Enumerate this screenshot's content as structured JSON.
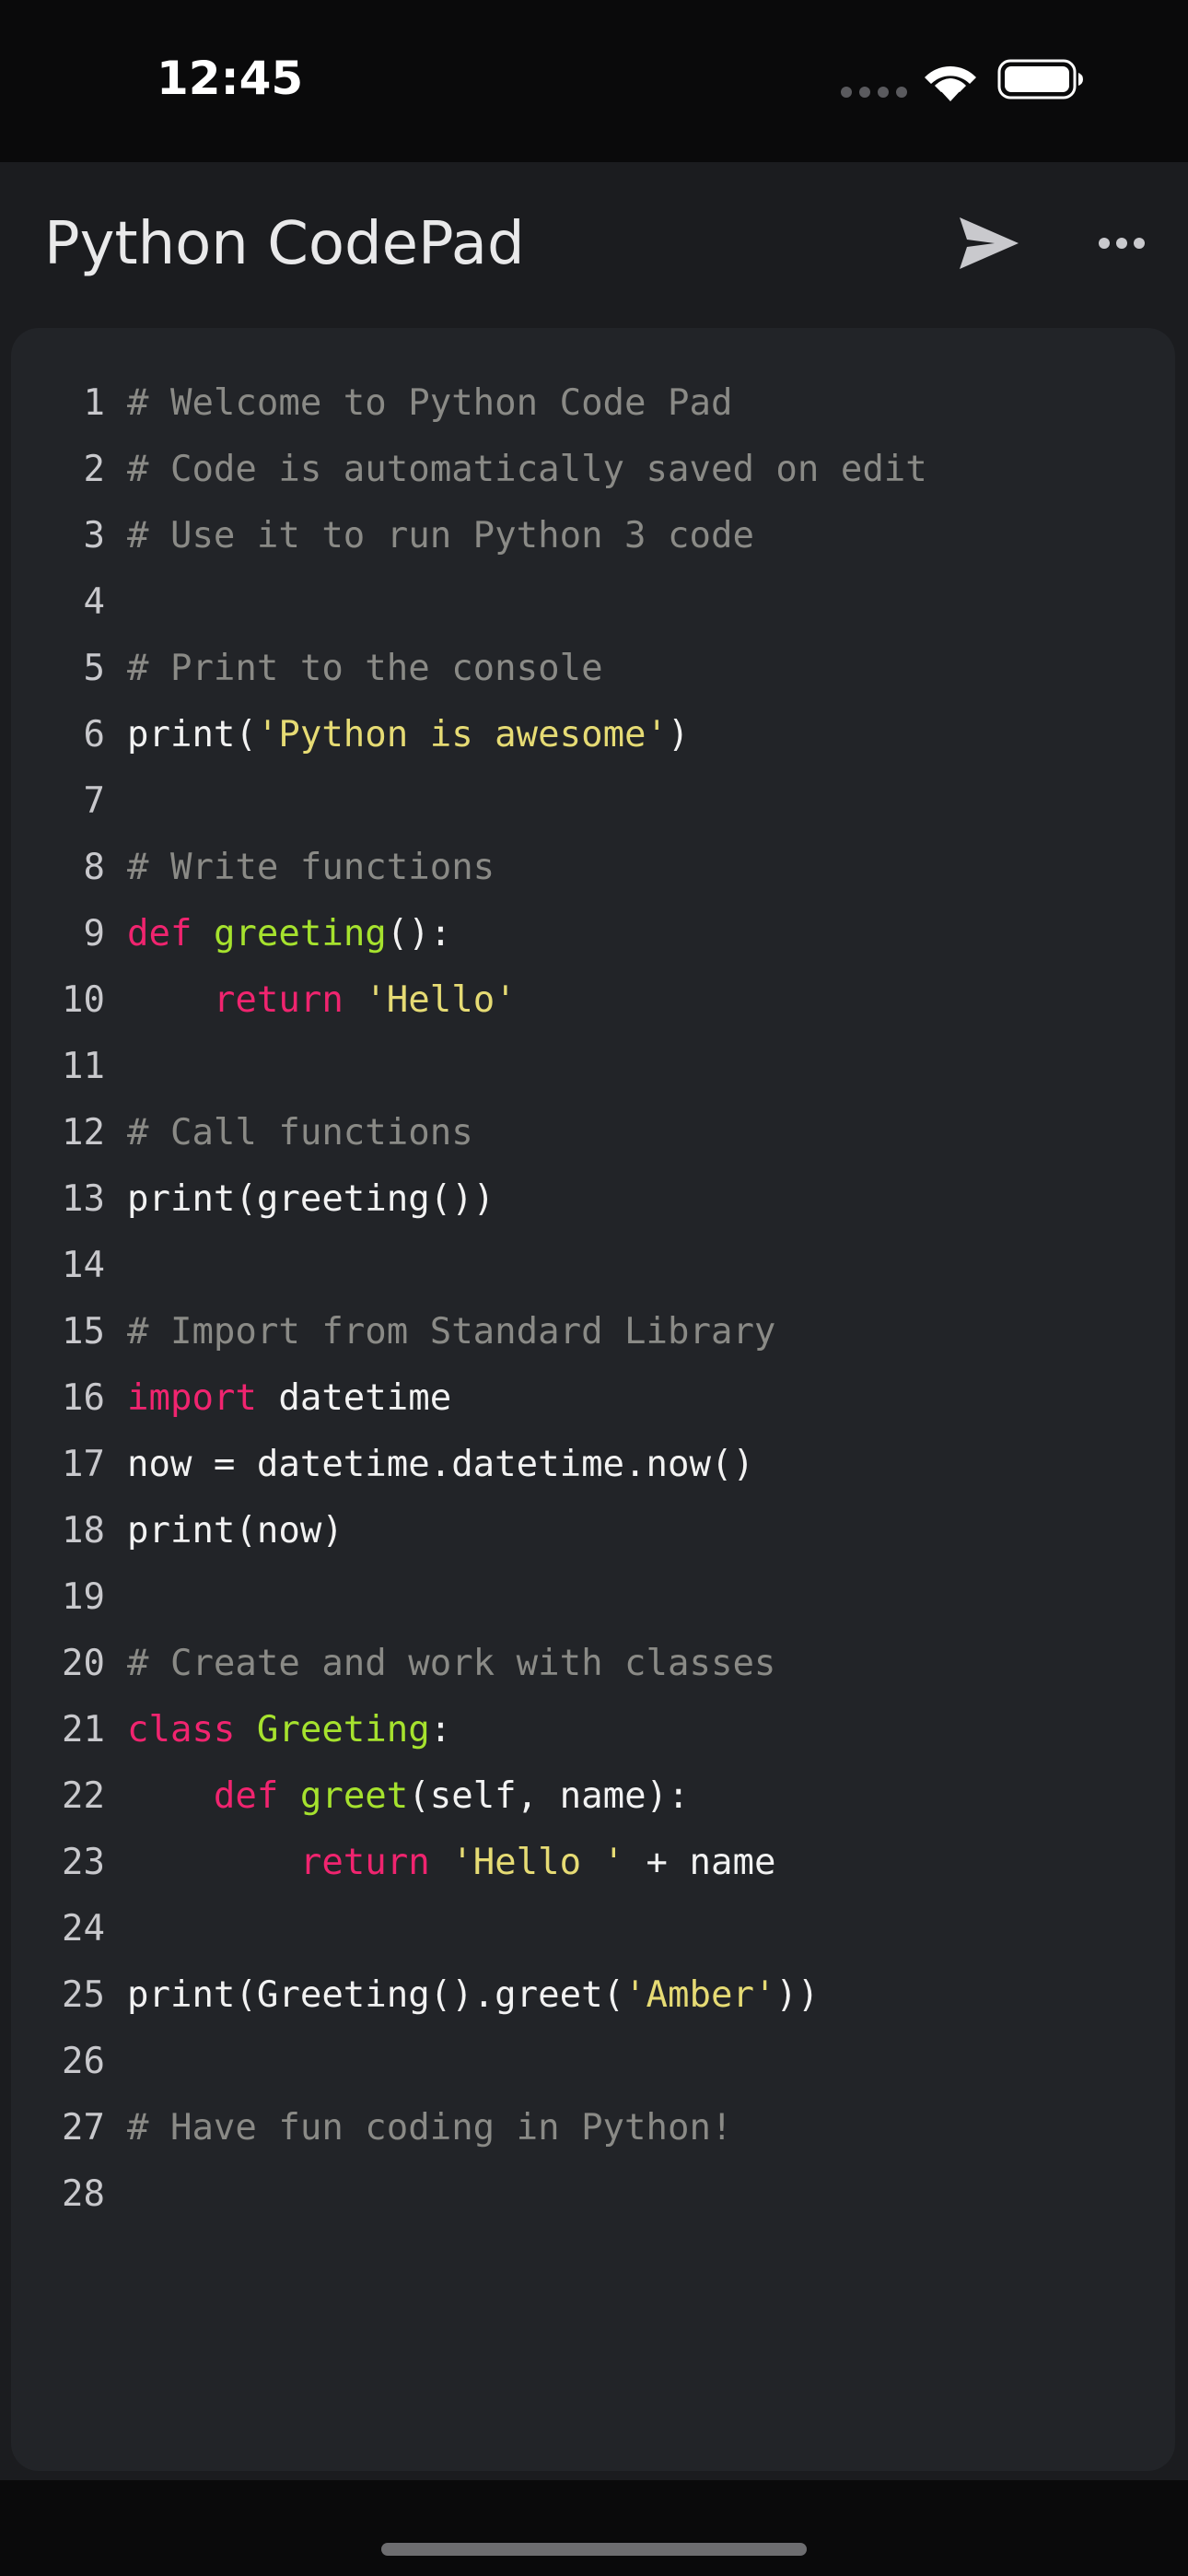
{
  "status_bar": {
    "time": "12:45",
    "icons": [
      "cellular-dots-icon",
      "wifi-icon",
      "battery-icon"
    ]
  },
  "app_bar": {
    "title": "Python CodePad",
    "run_icon": "send-icon",
    "more_icon": "more-horizontal-icon"
  },
  "colors": {
    "comment": "#8a8a86",
    "keyword": "#f0246f",
    "function": "#a6e22e",
    "string": "#e6db74",
    "plain": "#f2f2f2",
    "line_number": "#c8c8cc",
    "editor_background": "#222428",
    "app_background": "#1b1c1f"
  },
  "editor": {
    "lines": [
      {
        "n": "1",
        "tokens": [
          {
            "t": "comment",
            "v": "# Welcome to Python Code Pad"
          }
        ]
      },
      {
        "n": "2",
        "tokens": [
          {
            "t": "comment",
            "v": "# Code is automatically saved on edit"
          }
        ]
      },
      {
        "n": "3",
        "tokens": [
          {
            "t": "comment",
            "v": "# Use it to run Python 3 code"
          }
        ]
      },
      {
        "n": "4",
        "tokens": []
      },
      {
        "n": "5",
        "tokens": [
          {
            "t": "comment",
            "v": "# Print to the console"
          }
        ]
      },
      {
        "n": "6",
        "tokens": [
          {
            "t": "plain",
            "v": "print("
          },
          {
            "t": "string",
            "v": "'Python is awesome'"
          },
          {
            "t": "plain",
            "v": ")"
          }
        ]
      },
      {
        "n": "7",
        "tokens": []
      },
      {
        "n": "8",
        "tokens": [
          {
            "t": "comment",
            "v": "# Write functions"
          }
        ]
      },
      {
        "n": "9",
        "tokens": [
          {
            "t": "keyword",
            "v": "def"
          },
          {
            "t": "plain",
            "v": " "
          },
          {
            "t": "func",
            "v": "greeting"
          },
          {
            "t": "plain",
            "v": "():"
          }
        ]
      },
      {
        "n": "10",
        "tokens": [
          {
            "t": "plain",
            "v": "    "
          },
          {
            "t": "keyword",
            "v": "return"
          },
          {
            "t": "plain",
            "v": " "
          },
          {
            "t": "string",
            "v": "'Hello'"
          }
        ]
      },
      {
        "n": "11",
        "tokens": []
      },
      {
        "n": "12",
        "tokens": [
          {
            "t": "comment",
            "v": "# Call functions"
          }
        ]
      },
      {
        "n": "13",
        "tokens": [
          {
            "t": "plain",
            "v": "print(greeting())"
          }
        ]
      },
      {
        "n": "14",
        "tokens": []
      },
      {
        "n": "15",
        "tokens": [
          {
            "t": "comment",
            "v": "# Import from Standard Library"
          }
        ]
      },
      {
        "n": "16",
        "tokens": [
          {
            "t": "keyword",
            "v": "import"
          },
          {
            "t": "plain",
            "v": " datetime"
          }
        ]
      },
      {
        "n": "17",
        "tokens": [
          {
            "t": "plain",
            "v": "now = datetime.datetime.now()"
          }
        ]
      },
      {
        "n": "18",
        "tokens": [
          {
            "t": "plain",
            "v": "print(now)"
          }
        ]
      },
      {
        "n": "19",
        "tokens": []
      },
      {
        "n": "20",
        "tokens": [
          {
            "t": "comment",
            "v": "# Create and work with classes"
          }
        ]
      },
      {
        "n": "21",
        "tokens": [
          {
            "t": "keyword",
            "v": "class"
          },
          {
            "t": "plain",
            "v": " "
          },
          {
            "t": "func",
            "v": "Greeting"
          },
          {
            "t": "plain",
            "v": ":"
          }
        ]
      },
      {
        "n": "22",
        "tokens": [
          {
            "t": "plain",
            "v": "    "
          },
          {
            "t": "keyword",
            "v": "def"
          },
          {
            "t": "plain",
            "v": " "
          },
          {
            "t": "func",
            "v": "greet"
          },
          {
            "t": "plain",
            "v": "(self, name):"
          }
        ]
      },
      {
        "n": "23",
        "tokens": [
          {
            "t": "plain",
            "v": "        "
          },
          {
            "t": "keyword",
            "v": "return"
          },
          {
            "t": "plain",
            "v": " "
          },
          {
            "t": "string",
            "v": "'Hello '"
          },
          {
            "t": "plain",
            "v": " + name"
          }
        ]
      },
      {
        "n": "24",
        "tokens": []
      },
      {
        "n": "25",
        "tokens": [
          {
            "t": "plain",
            "v": "print(Greeting().greet("
          },
          {
            "t": "string",
            "v": "'Amber'"
          },
          {
            "t": "plain",
            "v": "))"
          }
        ]
      },
      {
        "n": "26",
        "tokens": []
      },
      {
        "n": "27",
        "tokens": [
          {
            "t": "comment",
            "v": "# Have fun coding in Python!"
          }
        ]
      },
      {
        "n": "28",
        "tokens": []
      }
    ]
  }
}
